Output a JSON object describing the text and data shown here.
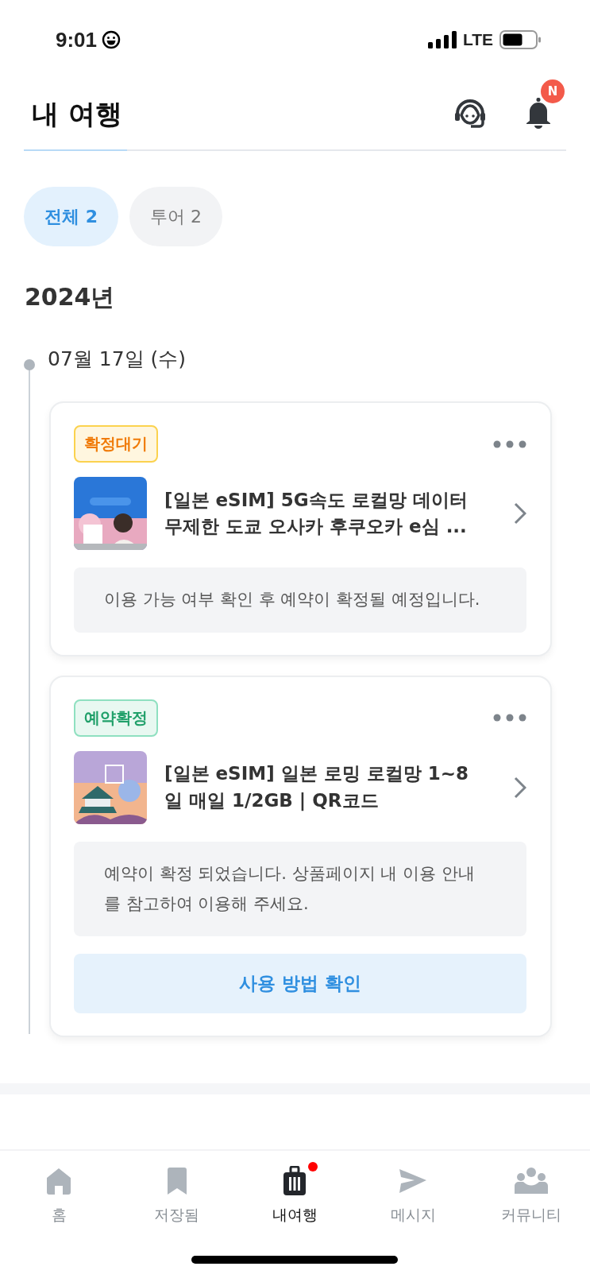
{
  "status_bar": {
    "time": "9:01",
    "network": "LTE"
  },
  "header": {
    "title": "내 여행",
    "notification_badge": "N"
  },
  "filters": [
    {
      "label": "전체 2",
      "selected": true
    },
    {
      "label": "투어 2",
      "selected": false
    }
  ],
  "year": "2024년",
  "date": "07월 17일 (수)",
  "bookings": [
    {
      "status": {
        "kind": "pending",
        "label": "확정대기"
      },
      "title": "[일본 eSIM] 5G속도 로컬망 데이터 무제한 도쿄 오사카 후쿠오카 e심 ...",
      "notice": "이용 가능 여부 확인 후 예약이 확정될 예정입니다."
    },
    {
      "status": {
        "kind": "confirmed",
        "label": "예약확정"
      },
      "title": "[일본 eSIM] 일본 로밍 로컬망 1~8일 매일 1/2GB | QR코드",
      "notice": "예약이 확정 되었습니다. 상품페이지 내 이용 안내를 참고하여 이용해 주세요.",
      "action": "사용 방법 확인"
    }
  ],
  "tab_bar": [
    {
      "kind": "home",
      "label": "홈",
      "selected": false,
      "dot": false
    },
    {
      "kind": "saved",
      "label": "저장됨",
      "selected": false,
      "dot": false
    },
    {
      "kind": "trips",
      "label": "내여행",
      "selected": true,
      "dot": true
    },
    {
      "kind": "messages",
      "label": "메시지",
      "selected": false,
      "dot": false
    },
    {
      "kind": "community",
      "label": "커뮤니티",
      "selected": false,
      "dot": false
    }
  ]
}
